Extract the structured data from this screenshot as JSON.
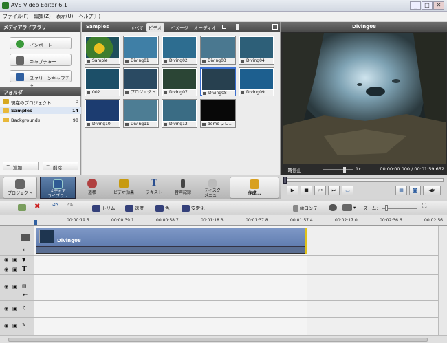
{
  "window": {
    "title": "AVS Video Editor 6.1",
    "controls": [
      "_",
      "□",
      "✕"
    ]
  },
  "menu": [
    "ファイル(F)",
    "編集(Z)",
    "表示(U)",
    "ヘルプ(H)"
  ],
  "media_library": {
    "title": "メディアライブラリ",
    "buttons": [
      "インポート",
      "キャプチャー",
      "スクリーンキャプチャ"
    ],
    "folders_title": "フォルダ",
    "folders": [
      {
        "name": "現在のプロジェクト",
        "count": "0"
      },
      {
        "name": "Samples",
        "count": "14"
      },
      {
        "name": "Backgrounds",
        "count": "98"
      }
    ],
    "add_label": "追加",
    "delete_label": "削除"
  },
  "thumbs": {
    "title": "Samples",
    "tabs": [
      "すべて",
      "ビデオ",
      "イメージ",
      "オーディオ"
    ],
    "active_tab": "ビデオ",
    "items": [
      "Sample",
      "Diving01",
      "Diving02",
      "Diving03",
      "Diving04",
      "002",
      "プロジェクト",
      "Diving07",
      "Diving08",
      "Diving09",
      "Diving10",
      "Diving11",
      "Diving12",
      "demo プロ..."
    ],
    "selected": "Diving08"
  },
  "preview": {
    "title": "Diving08",
    "state": "一時停止",
    "speed": "1x",
    "time": "00:00:00.000 / 00:01:59.652"
  },
  "big_toolbar": [
    {
      "label": "プロジェクト",
      "icon": "clapper-icon"
    },
    {
      "label": "メディア\nライブラリ",
      "icon": "media-library-icon",
      "active": true
    },
    {
      "label": "遷移",
      "icon": "transition-icon"
    },
    {
      "label": "ビデオ効果",
      "icon": "video-effects-icon"
    },
    {
      "label": "テキスト",
      "icon": "text-icon"
    },
    {
      "label": "音声記録",
      "icon": "microphone-icon"
    },
    {
      "label": "ディスク\nメニュー",
      "icon": "disc-menu-icon"
    },
    {
      "label": "作成...",
      "icon": "produce-icon"
    }
  ],
  "edit_toolbar": {
    "trim": "トリム",
    "speed": "速度",
    "color": "色",
    "stabilize": "安定化",
    "storyboard": "絵コンテ",
    "zoom": "ズーム:"
  },
  "ruler": [
    "00:00:19.5",
    "00:00:39.1",
    "00:00:58.7",
    "00:01:18.3",
    "00:01:37.8",
    "00:01:57.4",
    "00:02:17.0",
    "00:02:36.6",
    "00:02:56."
  ],
  "timeline": {
    "clip": "Diving08"
  }
}
